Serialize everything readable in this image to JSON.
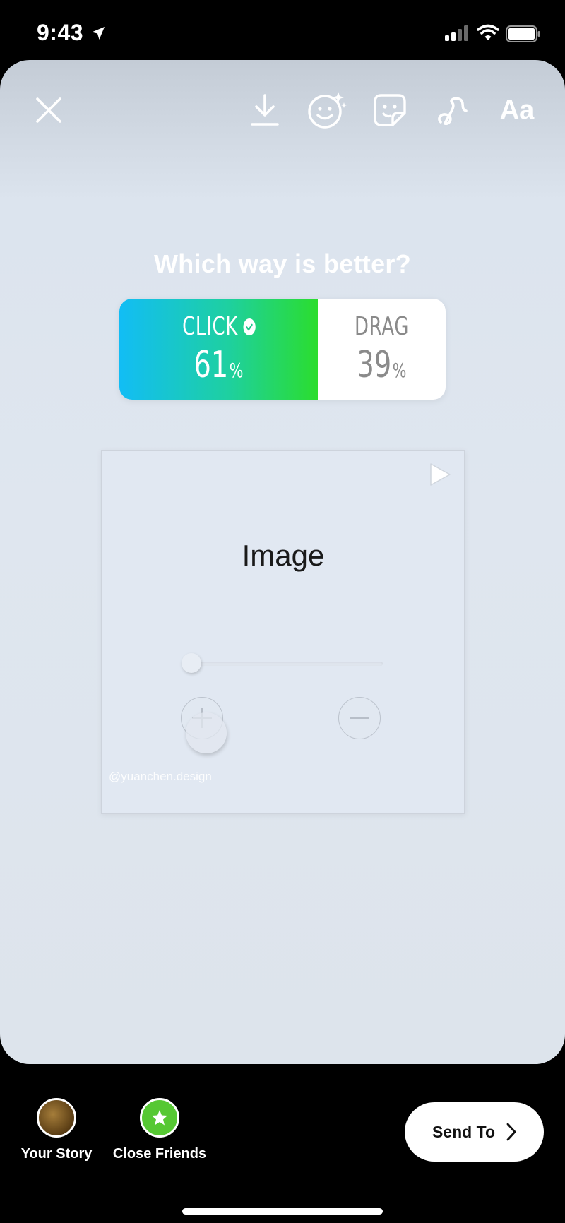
{
  "status_bar": {
    "time": "9:43"
  },
  "toolbar": {
    "text_tool_label": "Aa"
  },
  "poll": {
    "question": "Which way is better?",
    "options": [
      {
        "label": "CLICK",
        "percent": "61",
        "selected": true
      },
      {
        "label": "DRAG",
        "percent": "39",
        "selected": false
      }
    ],
    "percent_sign": "%"
  },
  "media": {
    "image_label": "Image",
    "slider_level": 0.0
  },
  "watermark": "@yuanchen.design",
  "share": {
    "your_story_label": "Your Story",
    "close_friends_label": "Close Friends",
    "send_label": "Send To"
  },
  "colors": {
    "poll_gradient_start": "#12bdf5",
    "poll_gradient_end": "#2bdd2e",
    "close_friends_green": "#56c833"
  }
}
